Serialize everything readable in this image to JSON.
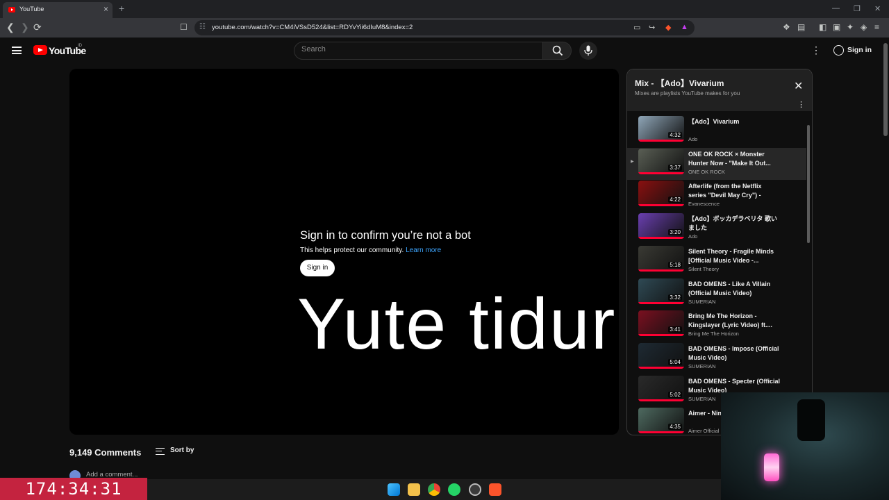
{
  "browser": {
    "tab_title": "YouTube",
    "tab_close": "×",
    "new_tab": "+",
    "url": "youtube.com/watch?v=CM4iVSsD524&list=RDYvYii6dIuM8&index=2",
    "window_controls": [
      "—",
      "❐",
      "✕"
    ]
  },
  "header": {
    "logo_text": "YouTube",
    "region": "ID",
    "search_placeholder": "Search",
    "signin_label": "Sign in"
  },
  "player": {
    "bot_title": "Sign in to confirm you’re not a bot",
    "bot_subtitle": "This helps protect our community.",
    "learn_more": "Learn more",
    "signin_button": "Sign in",
    "overlay_text": "Yute tidur"
  },
  "comments": {
    "count": "9,149 Comments",
    "sort_by": "Sort by",
    "add_comment": "Add a comment..."
  },
  "playlist": {
    "title": "Mix - 【Ado】Vivarium",
    "subtitle": "Mixes are playlists YouTube makes for you",
    "items": [
      {
        "title": "【Ado】Vivarium",
        "channel": "Ado",
        "duration": "4:32",
        "color": "#8fa6b8"
      },
      {
        "title": "ONE OK ROCK × Monster Hunter Now - \"Make It Out...",
        "channel": "ONE OK ROCK",
        "duration": "3:37",
        "color": "#5a5f55"
      },
      {
        "title": "Afterlife (from the Netflix series \"Devil May Cry\") - Offici...",
        "channel": "Evanescence",
        "duration": "4:22",
        "color": "#8a1010"
      },
      {
        "title": "【Ado】ボッカデラベリタ 歌いました",
        "channel": "Ado",
        "duration": "3:20",
        "color": "#6a3fb0"
      },
      {
        "title": "Silent Theory - Fragile Minds [Official Music Video -...",
        "channel": "Silent Theory",
        "duration": "5:18",
        "color": "#3a3a34"
      },
      {
        "title": "BAD OMENS - Like A Villain (Official Music Video)",
        "channel": "SUMERIAN",
        "duration": "3:32",
        "color": "#2f4a55"
      },
      {
        "title": "Bring Me The Horizon - Kingslayer (Lyric Video) ft....",
        "channel": "Bring Me The Horizon",
        "duration": "3:41",
        "color": "#7a1020"
      },
      {
        "title": "BAD OMENS - Impose (Official Music Video)",
        "channel": "SUMERIAN",
        "duration": "5:04",
        "color": "#1e2a33"
      },
      {
        "title": "BAD OMENS - Specter (Official Music Video)",
        "channel": "SUMERIAN",
        "duration": "5:02",
        "color": "#2a2a2a"
      },
      {
        "title": "Aimer - Nin",
        "channel": "Aimer Official",
        "duration": "4:35",
        "color": "#4e6a60"
      }
    ]
  },
  "timer": "174:34:31",
  "colors": {
    "accent_red": "#ff0000",
    "progress_red": "#ff0033",
    "link_blue": "#3ea6ff",
    "timer_bg": "#c4233f"
  }
}
